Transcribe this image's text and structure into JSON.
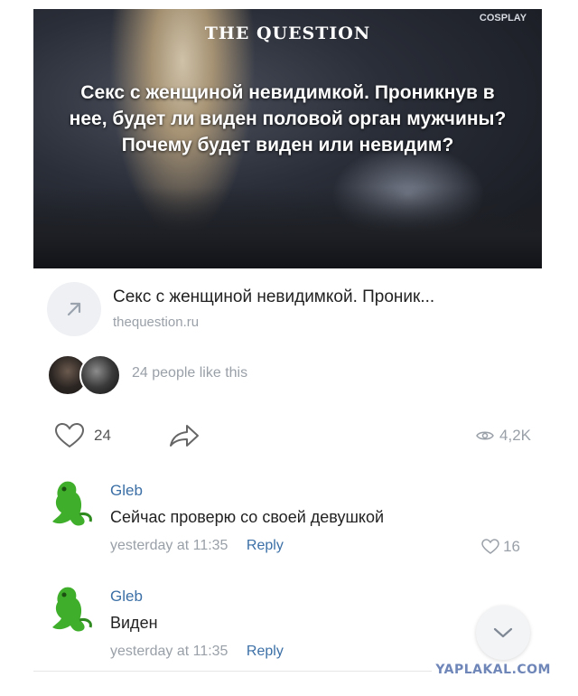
{
  "hero": {
    "brand": "THE QUESTION",
    "corner_logo": "COSPLAY",
    "text": "Секс с женщиной невидимкой. Проникнув в нее, будет ли виден половой орган мужчины? Почему будет виден или невидим?"
  },
  "link_card": {
    "title": "Секс с женщиной невидимкой. Проник...",
    "domain": "thequestion.ru",
    "icon": "arrow-up-right-icon"
  },
  "likes": {
    "text": "24 people like this"
  },
  "actions": {
    "likes_count": "24",
    "views": "4,2K"
  },
  "comments": [
    {
      "author": "Gleb",
      "text": "Сейчас проверю со своей девушкой",
      "time": "yesterday at 11:35",
      "reply_label": "Reply",
      "likes": "16"
    },
    {
      "author": "Gleb",
      "text": "Виден",
      "time": "yesterday at 11:35",
      "reply_label": "Reply"
    }
  ],
  "watermark": "YAPLAKAL.COM",
  "colors": {
    "link_blue": "#3b6fa6",
    "muted_gray": "#9aa0a8",
    "frog_green": "#3fae2a"
  }
}
